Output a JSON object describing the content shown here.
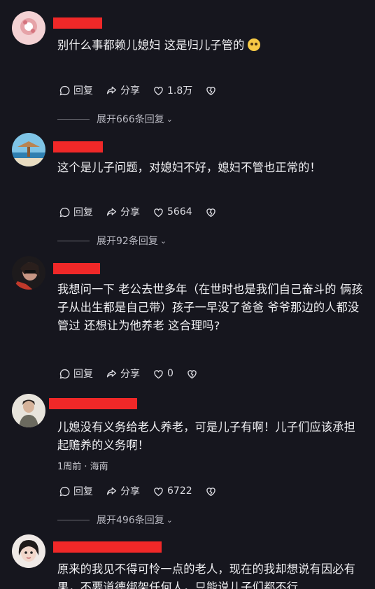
{
  "comments": [
    {
      "text": "别什么事都赖儿媳妇 这是归儿子管的",
      "emoji_icon": "sweat-smile-emoji",
      "reply_label": "回复",
      "share_label": "分享",
      "likes": "1.8万",
      "expand_label": "展开666条回复"
    },
    {
      "text": "这个是儿子问题，对媳妇不好，媳妇不管也正常的！",
      "reply_label": "回复",
      "share_label": "分享",
      "likes": "5664",
      "expand_label": "展开92条回复"
    },
    {
      "text": "我想问一下 老公去世多年（在世时也是我们自己奋斗的 俩孩子从出生都是自己带）孩子一早没了爸爸 爷爷那边的人都没管过 还想让为他养老 这合理吗?",
      "reply_label": "回复",
      "share_label": "分享",
      "likes": "0"
    },
    {
      "text": "儿媳没有义务给老人养老，可是儿子有啊！儿子们应该承担起赡养的义务啊！",
      "meta": "1周前 · 海南",
      "reply_label": "回复",
      "share_label": "分享",
      "likes": "6722",
      "expand_label": "展开496条回复"
    },
    {
      "text": "原来的我见不得可怜一点的老人，现在的我却想说有因必有果，不要道德绑架任何人，只能说儿子们都不行"
    }
  ],
  "colors": {
    "background": "#16161e",
    "redacted_name": "#f02828",
    "text": "#f1f1f4",
    "secondary": "#b9b9c2"
  }
}
